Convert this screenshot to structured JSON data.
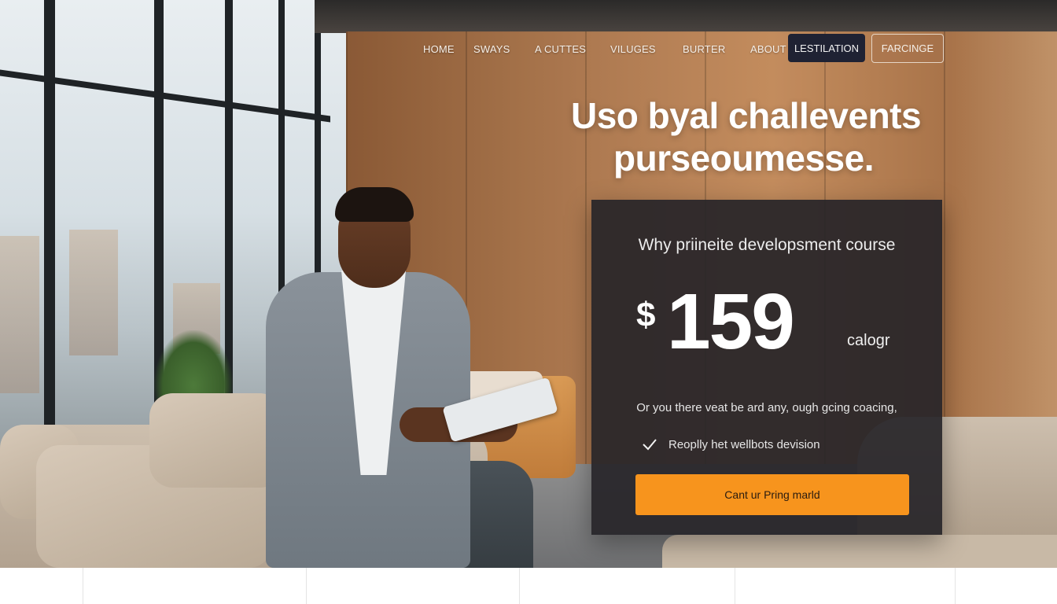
{
  "nav": {
    "links": [
      "HOME",
      "SWAYS",
      "A CUTTES",
      "VILUGES",
      "BURTER",
      "ABOUT"
    ],
    "dark_button": "LESTILATION",
    "outline_button": "FARCINGE"
  },
  "hero": {
    "headline_line1": "Uso byal challevents",
    "headline_line2": "purseoumesse."
  },
  "card": {
    "title": "Why priineite developsment course",
    "currency": "$",
    "price": "159",
    "period": "calogr",
    "description": "Or you there veat be ard any, ough gcing coacing,",
    "feature": "Reoplly het wellbots devision",
    "cta_label": "Cant ur Pring marld"
  },
  "colors": {
    "cta": "#f7941d",
    "card_bg": "#262428",
    "nav_dark_button": "#1f2233"
  },
  "icons": {
    "feature": "check-icon"
  }
}
